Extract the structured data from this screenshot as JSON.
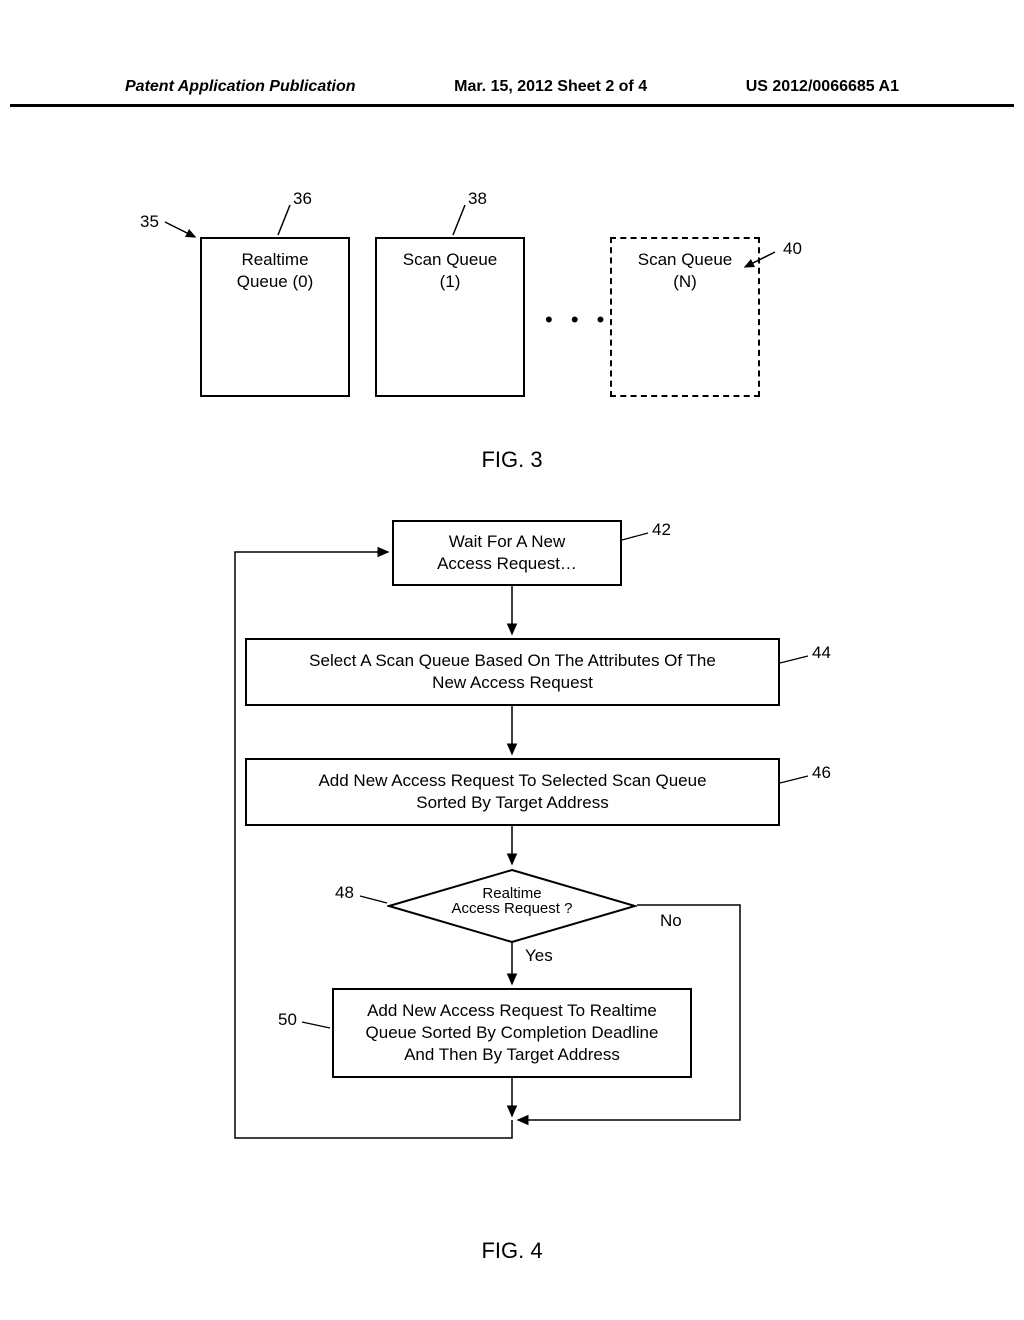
{
  "header": {
    "left": "Patent Application Publication",
    "center": "Mar. 15, 2012  Sheet 2 of 4",
    "right": "US 2012/0066685 A1"
  },
  "fig3": {
    "caption": "FIG. 3",
    "ref35": "35",
    "ref36": "36",
    "ref38": "38",
    "ref40": "40",
    "box1_line1": "Realtime",
    "box1_line2": "Queue (0)",
    "box2_line1": "Scan Queue",
    "box2_line2": "(1)",
    "box3_line1": "Scan Queue",
    "box3_line2": "(N)",
    "ellipsis": "• • •"
  },
  "fig4": {
    "caption": "FIG. 4",
    "box42_line1": "Wait For A New",
    "box42_line2": "Access Request…",
    "box44_line1": "Select A Scan Queue Based On The Attributes Of The",
    "box44_line2": "New Access Request",
    "box46_line1": "Add New Access Request To Selected Scan Queue",
    "box46_line2": "Sorted By Target Address",
    "dec48_line1": "Realtime",
    "dec48_line2": "Access Request ?",
    "box50_line1": "Add New Access Request To Realtime",
    "box50_line2": "Queue Sorted By Completion Deadline",
    "box50_line3": "And Then By Target Address",
    "ref42": "42",
    "ref44": "44",
    "ref46": "46",
    "ref48": "48",
    "ref50": "50",
    "yes": "Yes",
    "no": "No"
  }
}
